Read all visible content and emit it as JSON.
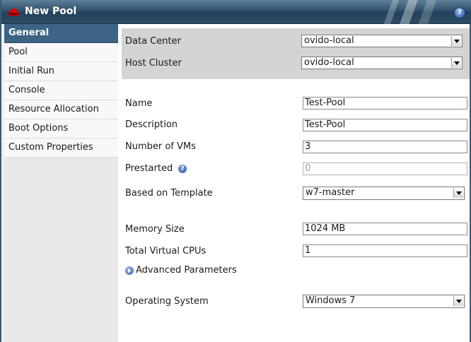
{
  "dialog": {
    "title": "New Pool",
    "help_glyph": "?",
    "logo_icon": "redhat-logo-icon"
  },
  "sidebar": {
    "items": [
      {
        "label": "General",
        "active": true
      },
      {
        "label": "Pool"
      },
      {
        "label": "Initial Run"
      },
      {
        "label": "Console"
      },
      {
        "label": "Resource Allocation"
      },
      {
        "label": "Boot Options"
      },
      {
        "label": "Custom Properties"
      }
    ]
  },
  "form": {
    "data_center": {
      "label": "Data Center",
      "value": "ovido-local"
    },
    "host_cluster": {
      "label": "Host Cluster",
      "value": "ovido-local"
    },
    "name": {
      "label": "Name",
      "value": "Test-Pool"
    },
    "description": {
      "label": "Description",
      "value": "Test-Pool"
    },
    "num_vms": {
      "label": "Number of VMs",
      "value": "3"
    },
    "prestarted": {
      "label": "Prestarted",
      "value": "0",
      "help_glyph": "?"
    },
    "template": {
      "label": "Based on Template",
      "value": "w7-master"
    },
    "memory": {
      "label": "Memory Size",
      "value": "1024 MB"
    },
    "cpus": {
      "label": "Total Virtual CPUs",
      "value": "1"
    },
    "advanced": {
      "label": "Advanced Parameters"
    },
    "os": {
      "label": "Operating System",
      "value": "Windows 7"
    }
  },
  "colors": {
    "titlebar": "#2f4d66",
    "active_nav": "#3d6385",
    "band": "#d4d4d4"
  }
}
